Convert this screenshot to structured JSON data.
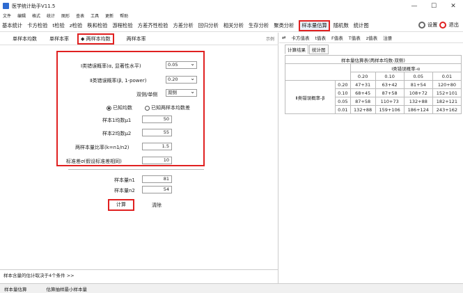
{
  "window": {
    "title": "医学统计助手V11.5"
  },
  "menu": [
    "文件",
    "编辑",
    "格式",
    "统计",
    "图形",
    "查表",
    "工具",
    "更新",
    "帮助"
  ],
  "toolbar": {
    "items": [
      "基本统计",
      "卡方检验",
      "t检验",
      "z检验",
      "秩和检验",
      "游程检验",
      "方差齐性检验",
      "方差分析",
      "回归分析",
      "相关分析",
      "生存分析",
      "聚类分析",
      "样本量估算",
      "随机数",
      "统计图"
    ],
    "active": "样本量估算",
    "settings": "设置",
    "exit": "退出"
  },
  "tabs": {
    "items": [
      "单样本均数",
      "单样本率",
      "两样本均数",
      "两样本率"
    ],
    "selected": "两样本均数",
    "example": "示例"
  },
  "form": {
    "alpha_label": "Ⅰ类错误概率(α, 显著性水平)",
    "alpha_value": "0.05",
    "beta_label": "Ⅱ类错误概率(β, 1-power)",
    "beta_value": "0.20",
    "side_label": "双侧/单侧",
    "side_value": "双侧",
    "radio_known": "已知均数",
    "radio_diff": "已知两样本均数差",
    "mu1_label": "样本1均数μ1",
    "mu1_value": "50",
    "mu2_label": "样本2均数μ2",
    "mu2_value": "55",
    "ratio_label": "两样本量比率(k=n1/n2)",
    "ratio_value": "1.5",
    "sd_label": "标准差σ(假设标准差相同)",
    "sd_value": "10",
    "n1_label": "样本量n1",
    "n1_value": "81",
    "n2_label": "样本量n2",
    "n2_value": "54",
    "calc": "计算",
    "clear": "清除"
  },
  "left_status": "样本含量的估计取决于4个条件   >>",
  "right": {
    "tools": [
      "卡方值表",
      "t值表",
      "F值表",
      "T值表",
      "z值表",
      "注册"
    ],
    "subtabs": [
      "计算结果",
      "统计图"
    ],
    "table_title": "样本量估算表(两样本均数-双侧)",
    "alpha_header": "Ⅰ类错误概率-α",
    "beta_header": "Ⅱ类错误概率-β",
    "alpha_cols": [
      "0.20",
      "0.10",
      "0.05",
      "0.01"
    ],
    "rows": [
      {
        "beta": "0.20",
        "cells": [
          "47+31",
          "63+42",
          "81+54",
          "120+80"
        ]
      },
      {
        "beta": "0.10",
        "cells": [
          "68+45",
          "87+58",
          "108+72",
          "152+101"
        ]
      },
      {
        "beta": "0.05",
        "cells": [
          "87+58",
          "110+73",
          "132+88",
          "182+121"
        ]
      },
      {
        "beta": "0.01",
        "cells": [
          "132+88",
          "159+106",
          "186+124",
          "243+162"
        ]
      }
    ]
  },
  "statusbar": [
    "样本量估算",
    "估算抽样最小样本量"
  ]
}
